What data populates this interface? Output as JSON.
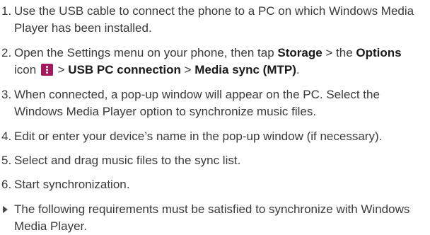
{
  "steps": [
    {
      "num": "1.",
      "text": "Use the USB cable to connect the phone to a PC on which Windows Media Player has been installed."
    },
    {
      "num": "2.",
      "prefix": "Open the Settings menu on your phone, then tap ",
      "storage": "Storage",
      "sep1": " > the ",
      "options": "Options",
      "icon_suffix": " icon ",
      "icon": "options-menu-icon",
      "sep2": " > ",
      "usb": "USB PC connection",
      "sep3": " > ",
      "media": "Media sync (MTP)",
      "end": "."
    },
    {
      "num": "3.",
      "text": "When connected, a pop-up window will appear on the PC. Select the Windows Media Player option to synchronize music files."
    },
    {
      "num": "4.",
      "text": "Edit or enter your device’s name in the pop-up window (if necessary)."
    },
    {
      "num": "5.",
      "text": "Select and drag music files to the sync list."
    },
    {
      "num": "6.",
      "text": "Start synchronization."
    }
  ],
  "note": {
    "icon": "triangle-bullet-icon",
    "text": "The following requirements must be satisfied to synchronize with Windows Media Player."
  },
  "colors": {
    "text": "#3a3a3a",
    "icon_bg": "#a3195b"
  }
}
